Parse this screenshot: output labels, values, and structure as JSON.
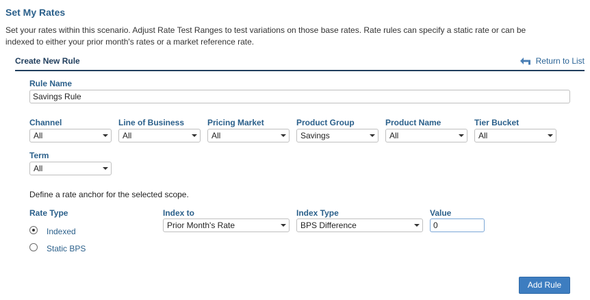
{
  "page": {
    "title": "Set My Rates",
    "description": "Set your rates within this scenario. Adjust Rate Test Ranges to test variations on those base rates. Rate rules can specify a static rate or can be indexed to either your prior month's rates or a market reference rate."
  },
  "section": {
    "title": "Create New Rule",
    "return_label": "Return to List"
  },
  "rule_name": {
    "label": "Rule Name",
    "value": "Savings Rule"
  },
  "filters": {
    "channel": {
      "label": "Channel",
      "value": "All"
    },
    "line_of_business": {
      "label": "Line of Business",
      "value": "All"
    },
    "pricing_market": {
      "label": "Pricing Market",
      "value": "All"
    },
    "product_group": {
      "label": "Product Group",
      "value": "Savings"
    },
    "product_name": {
      "label": "Product Name",
      "value": "All"
    },
    "tier_bucket": {
      "label": "Tier Bucket",
      "value": "All"
    },
    "term": {
      "label": "Term",
      "value": "All"
    }
  },
  "anchor_text": "Define a rate anchor for the selected scope.",
  "rate_type": {
    "label": "Rate Type",
    "options": [
      {
        "label": "Indexed",
        "selected": true
      },
      {
        "label": "Static BPS",
        "selected": false
      }
    ]
  },
  "index_to": {
    "label": "Index to",
    "value": "Prior Month's Rate"
  },
  "index_type": {
    "label": "Index Type",
    "value": "BPS Difference"
  },
  "value_field": {
    "label": "Value",
    "value": "0"
  },
  "actions": {
    "add_rule_label": "Add Rule"
  },
  "icons": {
    "return": "return-arrow-icon",
    "dropdown": "chevron-down-icon"
  },
  "colors": {
    "heading": "#2a5f8a",
    "section_rule": "#1f3d5c",
    "button": "#3d7dc0",
    "link": "#2a6496"
  }
}
